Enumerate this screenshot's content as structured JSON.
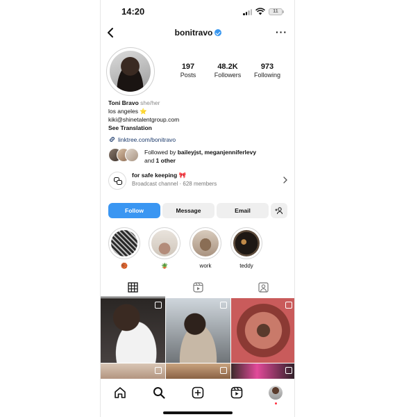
{
  "status_bar": {
    "time": "14:20",
    "battery": "11"
  },
  "header": {
    "username": "bonitravo"
  },
  "stats": [
    {
      "num": "197",
      "label": "Posts"
    },
    {
      "num": "48.2K",
      "label": "Followers"
    },
    {
      "num": "973",
      "label": "Following"
    }
  ],
  "bio": {
    "name": "Toni Bravo",
    "pronouns": "she/her",
    "line1": "los angeles ⭐",
    "line2": "kiki@shinetalentgroup.com",
    "see_translation": "See Translation"
  },
  "link": "linktree.com/bonitravo",
  "followed_by": {
    "prefix": "Followed by ",
    "names": "baileyjst, meganjenniferlevy",
    "and": "and ",
    "other": "1 other"
  },
  "broadcast": {
    "title": "for safe keeping 🎀",
    "subtitle": "Broadcast channel · 628 members"
  },
  "buttons": {
    "follow": "Follow",
    "message": "Message",
    "email": "Email"
  },
  "highlights": [
    {
      "caption": "🏀"
    },
    {
      "caption": "🪴"
    },
    {
      "caption": "work"
    },
    {
      "caption": "teddy"
    }
  ],
  "colors": {
    "accent": "#3a96f2",
    "verified": "#3897f0",
    "notification_dot": "#ff3040"
  },
  "icons": {
    "back": "chevron-left-icon",
    "more": "more-icon",
    "link": "link-icon",
    "tab_grid": "grid-icon",
    "tab_reels": "reels-icon",
    "tab_tagged": "tagged-icon",
    "nav": [
      "home-icon",
      "search-icon",
      "create-icon",
      "reels-icon",
      "profile-avatar"
    ]
  }
}
